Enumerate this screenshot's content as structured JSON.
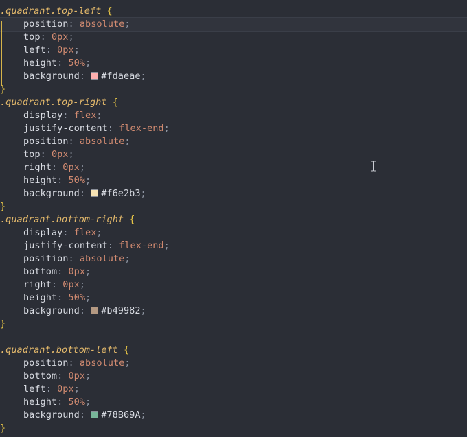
{
  "blocks": [
    {
      "selector": ".quadrant.top-left",
      "lines": [
        {
          "prop": "position",
          "value": "absolute",
          "type": "kw"
        },
        {
          "prop": "top",
          "value": "0px",
          "type": "num"
        },
        {
          "prop": "left",
          "value": "0px",
          "type": "num"
        },
        {
          "prop": "height",
          "value": "50%",
          "type": "num"
        },
        {
          "prop": "background",
          "value": "#fdaeae",
          "type": "color"
        }
      ],
      "close": "}"
    },
    {
      "selector": ".quadrant.top-right",
      "lines": [
        {
          "prop": "display",
          "value": "flex",
          "type": "kw"
        },
        {
          "prop": "justify-content",
          "value": "flex-end",
          "type": "kw"
        },
        {
          "prop": "position",
          "value": "absolute",
          "type": "kw"
        },
        {
          "prop": "top",
          "value": "0px",
          "type": "num"
        },
        {
          "prop": "right",
          "value": "0px",
          "type": "num"
        },
        {
          "prop": "height",
          "value": "50%",
          "type": "num"
        },
        {
          "prop": "background",
          "value": "#f6e2b3",
          "type": "color"
        }
      ],
      "close": "}"
    },
    {
      "selector": ".quadrant.bottom-right",
      "lines": [
        {
          "prop": "display",
          "value": "flex",
          "type": "kw"
        },
        {
          "prop": "justify-content",
          "value": "flex-end",
          "type": "kw"
        },
        {
          "prop": "position",
          "value": "absolute",
          "type": "kw"
        },
        {
          "prop": "bottom",
          "value": "0px",
          "type": "num"
        },
        {
          "prop": "right",
          "value": "0px",
          "type": "num"
        },
        {
          "prop": "height",
          "value": "50%",
          "type": "num"
        },
        {
          "prop": "background",
          "value": "#b49982",
          "type": "color"
        }
      ],
      "close": "}"
    },
    {
      "selector": ".quadrant.bottom-left",
      "lines": [
        {
          "prop": "position",
          "value": "absolute",
          "type": "kw"
        },
        {
          "prop": "bottom",
          "value": "0px",
          "type": "num"
        },
        {
          "prop": "left",
          "value": "0px",
          "type": "num"
        },
        {
          "prop": "height",
          "value": "50%",
          "type": "num"
        },
        {
          "prop": "background",
          "value": "#78B69A",
          "type": "color"
        }
      ],
      "close": "}"
    }
  ],
  "cursor_icon": "text-cursor-icon"
}
